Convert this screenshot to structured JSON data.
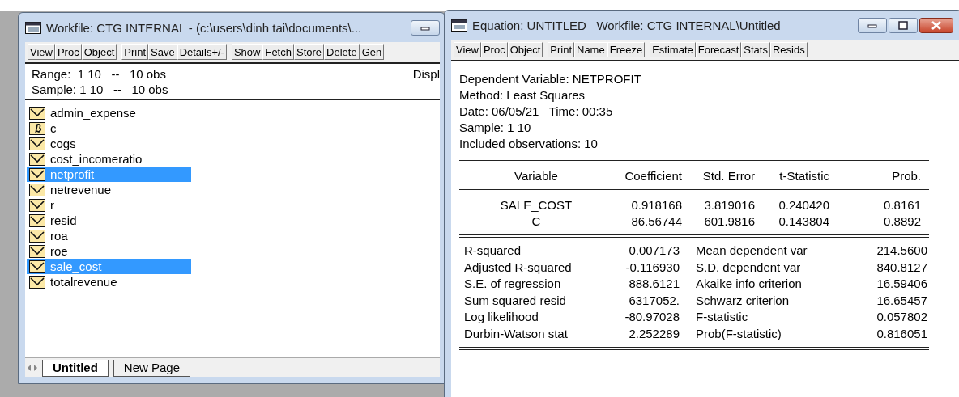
{
  "workfile_window": {
    "title": "Workfile: CTG INTERNAL - (c:\\users\\dinh tai\\documents\\...",
    "toolbar_groups": [
      [
        "View",
        "Proc",
        "Object"
      ],
      [
        "Print",
        "Save",
        "Details+/-"
      ],
      [
        "Show",
        "Fetch",
        "Store",
        "Delete",
        "Gen"
      ]
    ],
    "info_lines": [
      "Range:  1 10   --   10 obs",
      "Sample: 1 10   --   10 obs"
    ],
    "display_label": "Displ",
    "objects": [
      {
        "name": "admin_expense",
        "kind": "series",
        "selected": false
      },
      {
        "name": "c",
        "kind": "coef",
        "selected": false
      },
      {
        "name": "cogs",
        "kind": "series",
        "selected": false
      },
      {
        "name": "cost_incomeratio",
        "kind": "series",
        "selected": false
      },
      {
        "name": "netprofit",
        "kind": "series",
        "selected": true
      },
      {
        "name": "netrevenue",
        "kind": "series",
        "selected": false
      },
      {
        "name": "r",
        "kind": "series",
        "selected": false
      },
      {
        "name": "resid",
        "kind": "series",
        "selected": false
      },
      {
        "name": "roa",
        "kind": "series",
        "selected": false
      },
      {
        "name": "roe",
        "kind": "series",
        "selected": false
      },
      {
        "name": "sale_cost",
        "kind": "series",
        "selected": true
      },
      {
        "name": "totalrevenue",
        "kind": "series",
        "selected": false
      }
    ],
    "tabs": [
      {
        "label": "Untitled",
        "selected": true
      },
      {
        "label": "New Page",
        "selected": false
      }
    ]
  },
  "equation_window": {
    "title": "Equation: UNTITLED   Workfile: CTG INTERNAL\\Untitled",
    "toolbar_groups": [
      [
        "View",
        "Proc",
        "Object"
      ],
      [
        "Print",
        "Name",
        "Freeze"
      ],
      [
        "Estimate",
        "Forecast",
        "Stats",
        "Resids"
      ]
    ],
    "header_lines": [
      "Dependent Variable: NETPROFIT",
      "Method: Least Squares",
      "Date: 06/05/21   Time: 00:35",
      "Sample: 1 10",
      "Included observations: 10"
    ],
    "columns": [
      "Variable",
      "Coefficient",
      "Std. Error",
      "t-Statistic",
      "Prob."
    ],
    "rows": [
      [
        "SALE_COST",
        "0.918168",
        "3.819016",
        "0.240420",
        "0.8161"
      ],
      [
        "C",
        "86.56744",
        "601.9816",
        "0.143804",
        "0.8892"
      ]
    ],
    "stats": [
      [
        "R-squared",
        "0.007173",
        "Mean dependent var",
        "214.5600"
      ],
      [
        "Adjusted R-squared",
        "-0.116930",
        "S.D. dependent var",
        "840.8127"
      ],
      [
        "S.E. of regression",
        "888.6121",
        "Akaike info criterion",
        "16.59406"
      ],
      [
        "Sum squared resid",
        "6317052.",
        "Schwarz criterion",
        "16.65457"
      ],
      [
        "Log likelihood",
        "-80.97028",
        "F-statistic",
        "0.057802"
      ],
      [
        "Durbin-Watson stat",
        "2.252289",
        "Prob(F-statistic)",
        "0.816051"
      ]
    ]
  }
}
